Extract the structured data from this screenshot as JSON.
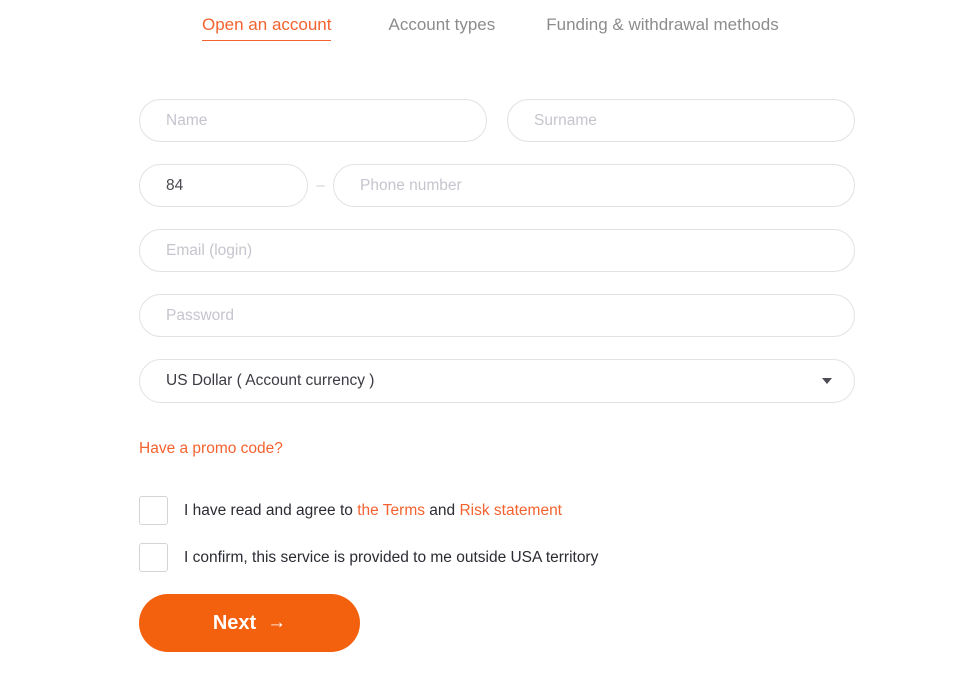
{
  "tabs": [
    {
      "label": "Open an account",
      "active": true
    },
    {
      "label": "Account types",
      "active": false
    },
    {
      "label": "Funding & withdrawal methods",
      "active": false
    }
  ],
  "form": {
    "name": {
      "value": "",
      "placeholder": "Name"
    },
    "surname": {
      "value": "",
      "placeholder": "Surname"
    },
    "country_code": {
      "value": "84",
      "placeholder": ""
    },
    "separator": "–",
    "phone": {
      "value": "",
      "placeholder": "Phone number"
    },
    "email": {
      "value": "",
      "placeholder": "Email (login)"
    },
    "password": {
      "value": "",
      "placeholder": "Password"
    },
    "currency": {
      "selected": "US Dollar ( Account currency )",
      "icon": "chevron-down-icon"
    },
    "promo_link": "Have a promo code?"
  },
  "agreements": [
    {
      "checked": false,
      "text_before": "I have read and agree to ",
      "link1": "the Terms",
      "text_middle": " and ",
      "link2": "Risk statement"
    },
    {
      "checked": false,
      "text": "I confirm, this service is provided to me outside USA territory"
    }
  ],
  "submit": {
    "label": "Next",
    "arrow": "→"
  },
  "colors": {
    "brand_orange": "#f4622f",
    "button_orange": "#f4610e",
    "tab_inactive": "#8c8c8c",
    "border": "#e2e2e6",
    "placeholder": "#c5c5ce",
    "text": "#2b2b33"
  }
}
